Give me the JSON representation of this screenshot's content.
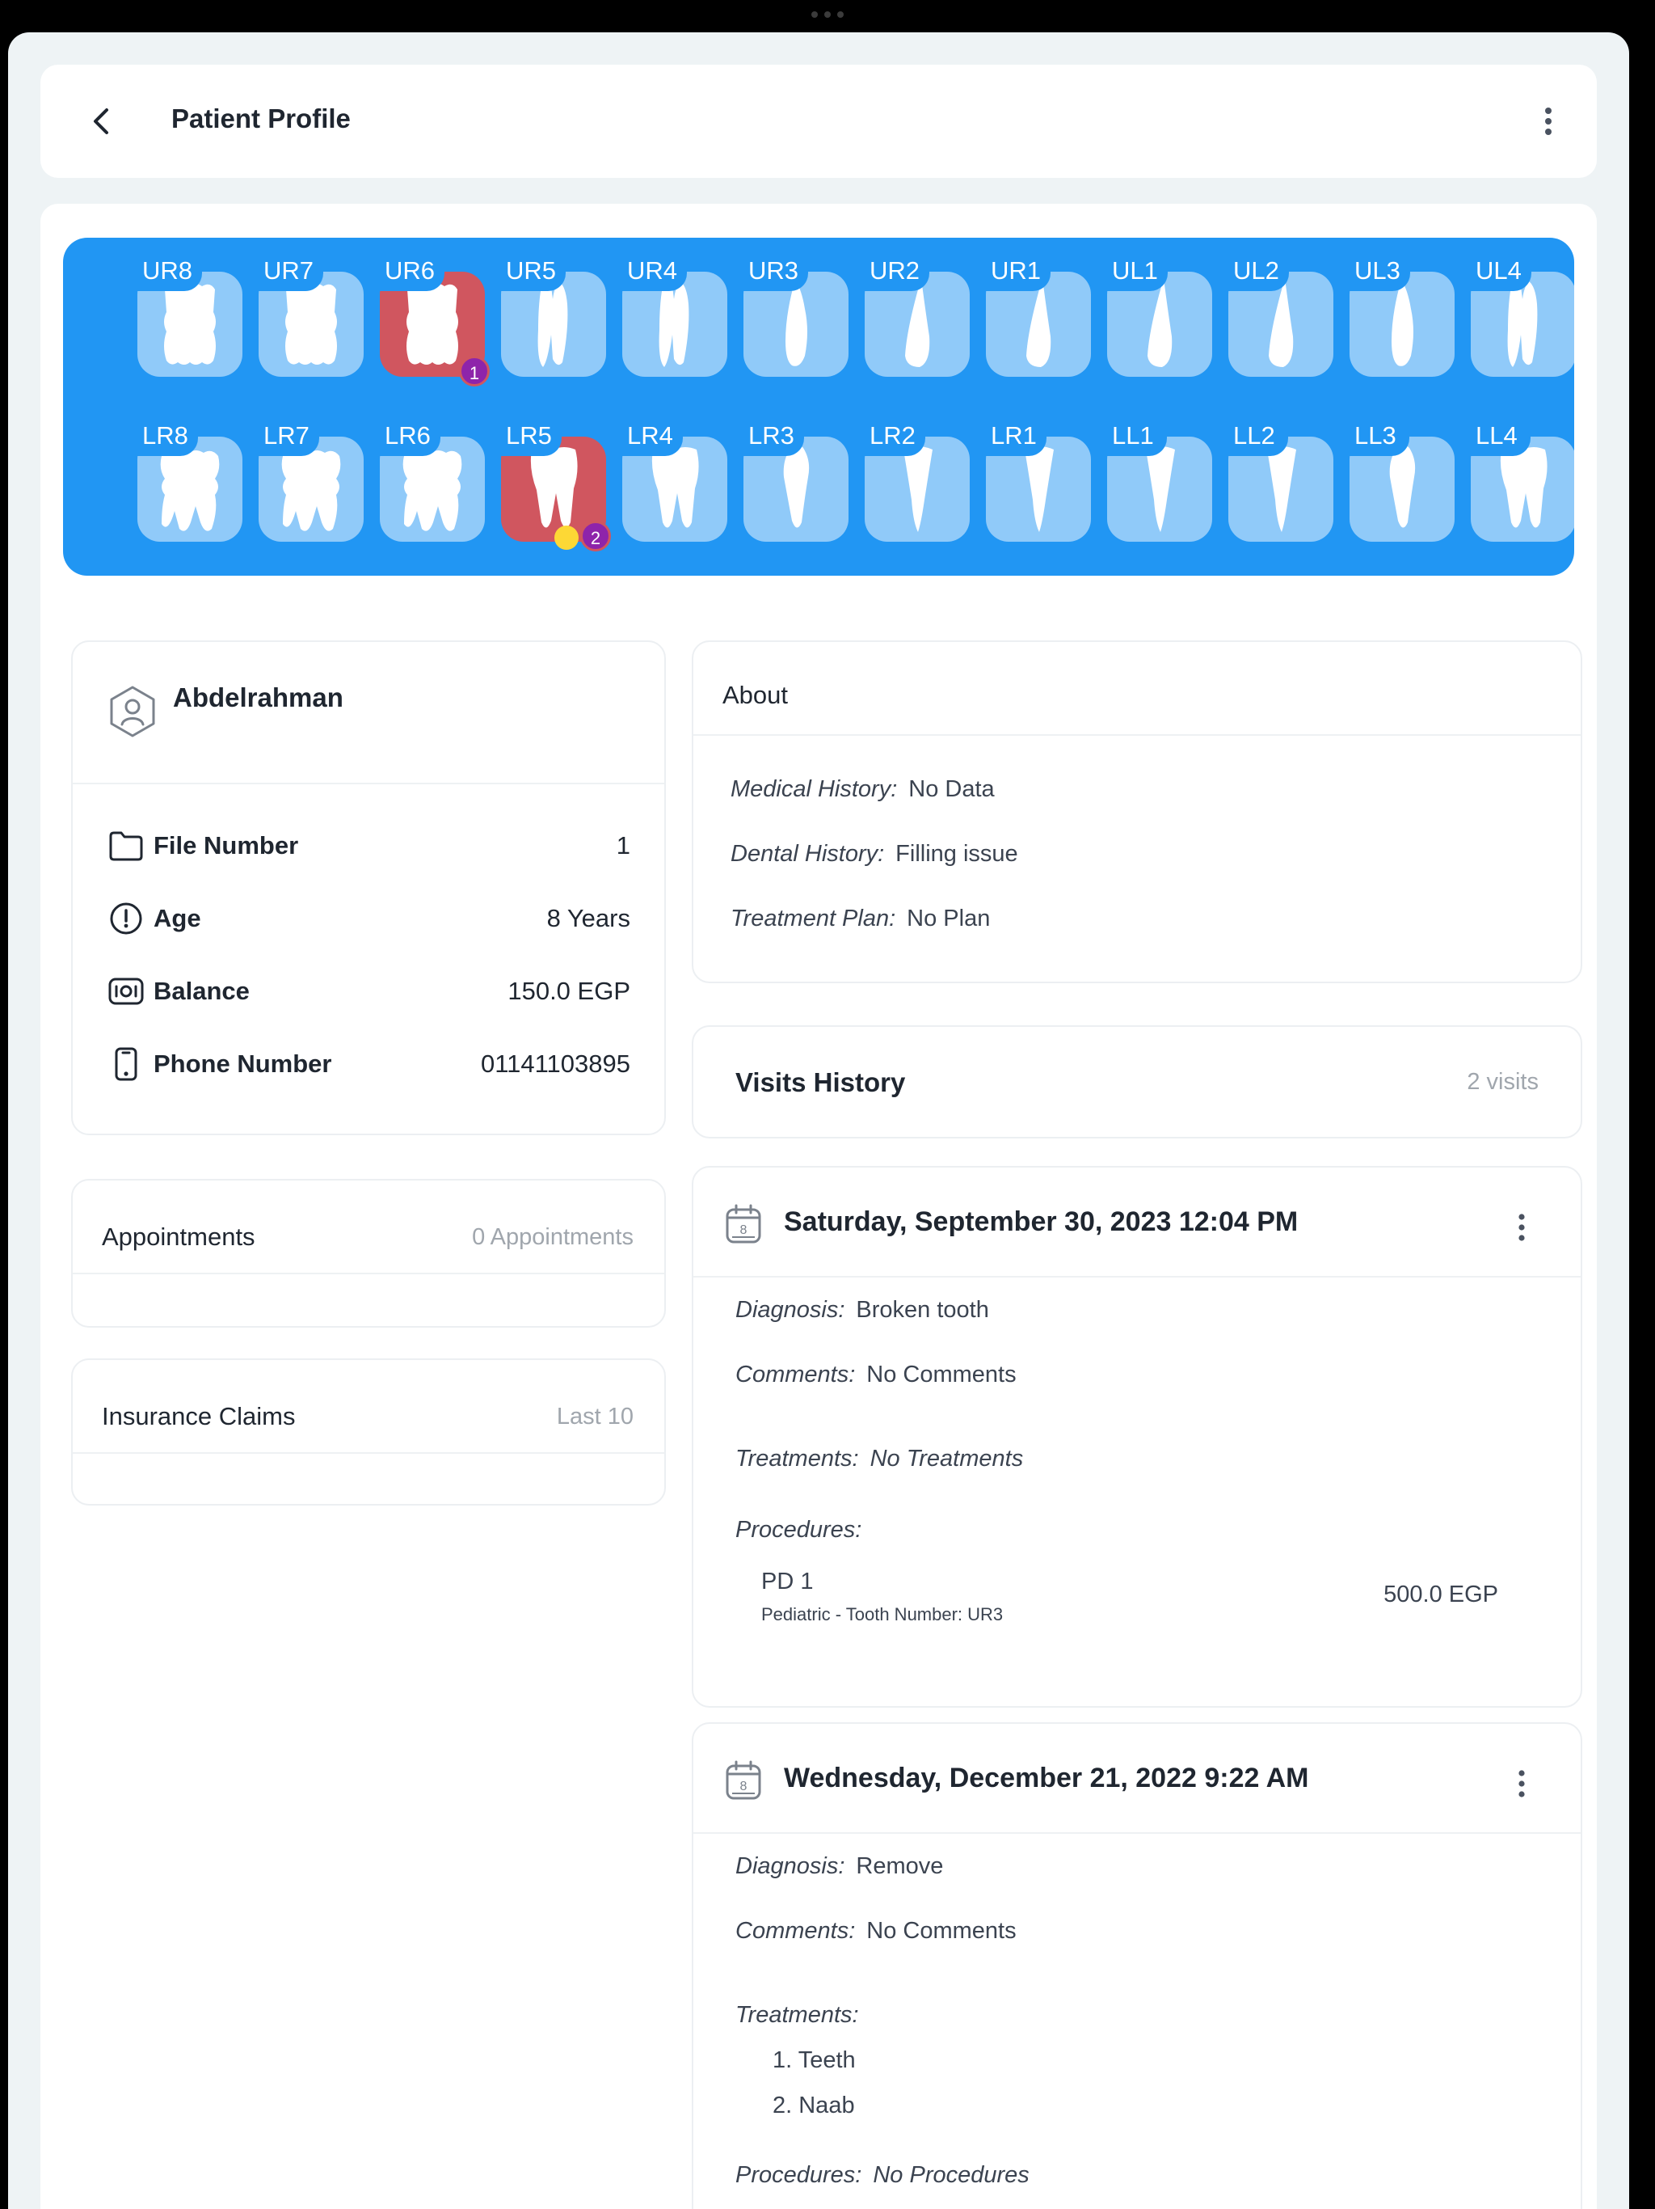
{
  "header": {
    "title": "Patient Profile"
  },
  "teeth": {
    "upper": [
      {
        "label": "UR8",
        "kind": "molar3"
      },
      {
        "label": "UR7",
        "kind": "molar3"
      },
      {
        "label": "UR6",
        "kind": "molar3",
        "highlight": true,
        "badge": "1"
      },
      {
        "label": "UR5",
        "kind": "premolar2"
      },
      {
        "label": "UR4",
        "kind": "premolar2"
      },
      {
        "label": "UR3",
        "kind": "canine"
      },
      {
        "label": "UR2",
        "kind": "incisor"
      },
      {
        "label": "UR1",
        "kind": "incisor"
      },
      {
        "label": "UL1",
        "kind": "incisor"
      },
      {
        "label": "UL2",
        "kind": "incisor"
      },
      {
        "label": "UL3",
        "kind": "canine"
      },
      {
        "label": "UL4",
        "kind": "premolar2"
      }
    ],
    "lower": [
      {
        "label": "LR8",
        "kind": "lmolar"
      },
      {
        "label": "LR7",
        "kind": "lmolar"
      },
      {
        "label": "LR6",
        "kind": "lmolar"
      },
      {
        "label": "LR5",
        "kind": "lpremolar",
        "highlight": true,
        "badge": "2",
        "dot": true
      },
      {
        "label": "LR4",
        "kind": "lpremolar"
      },
      {
        "label": "LR3",
        "kind": "lcanine"
      },
      {
        "label": "LR2",
        "kind": "lincisor"
      },
      {
        "label": "LR1",
        "kind": "lincisor"
      },
      {
        "label": "LL1",
        "kind": "lincisor"
      },
      {
        "label": "LL2",
        "kind": "lincisor"
      },
      {
        "label": "LL3",
        "kind": "lcanine"
      },
      {
        "label": "LL4",
        "kind": "lpremolar"
      }
    ]
  },
  "patient": {
    "name": "Abdelrahman",
    "rows": [
      {
        "icon": "folder-icon",
        "label": "File Number",
        "value": "1"
      },
      {
        "icon": "alert-circle-icon",
        "label": "Age",
        "value": "8 Years"
      },
      {
        "icon": "money-icon",
        "label": "Balance",
        "value": "150.0 EGP"
      },
      {
        "icon": "phone-icon",
        "label": "Phone Number",
        "value": "01141103895"
      }
    ]
  },
  "appointments": {
    "title": "Appointments",
    "count": "0 Appointments"
  },
  "insurance": {
    "title": "Insurance Claims",
    "right": "Last 10"
  },
  "about": {
    "title": "About",
    "items": [
      {
        "label": "Medical History:",
        "value": "No Data"
      },
      {
        "label": "Dental History:",
        "value": "Filling issue"
      },
      {
        "label": "Treatment Plan:",
        "value": "No Plan"
      }
    ]
  },
  "visits_history": {
    "title": "Visits History",
    "count": "2 visits"
  },
  "visits": [
    {
      "date": "Saturday, September 30, 2023 12:04 PM",
      "calendar_day": "8",
      "diagnosis_label": "Diagnosis:",
      "diagnosis": "Broken tooth",
      "comments_label": "Comments:",
      "comments": "No Comments",
      "treatments_label": "Treatments:",
      "treatments": "No Treatments",
      "procedures_label": "Procedures:",
      "procedure": {
        "name": "PD 1",
        "sub": "Pediatric  - Tooth Number: UR3",
        "price": "500.0 EGP"
      }
    },
    {
      "date": "Wednesday, December 21, 2022 9:22 AM",
      "calendar_day": "8",
      "diagnosis_label": "Diagnosis:",
      "diagnosis": "Remove",
      "comments_label": "Comments:",
      "comments": "No Comments",
      "treatments_label": "Treatments:",
      "treatment_items": [
        "1. Teeth",
        "2. Naab"
      ],
      "procedures_label": "Procedures:",
      "procedures": "No Procedures"
    }
  ],
  "colors": {
    "accent": "#2196f3",
    "tooth_tile": "#90caf9",
    "highlight": "#d0565f",
    "badge": "#8e24aa",
    "dot": "#fdd835"
  }
}
